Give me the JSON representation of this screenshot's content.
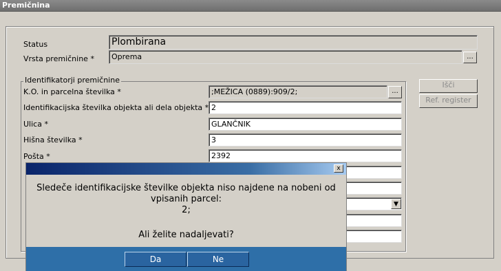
{
  "window": {
    "title": "Premičnina"
  },
  "status": {
    "label": "Status",
    "value": "Plombirana"
  },
  "vrsta": {
    "label": "Vrsta premičnine *",
    "value": "Oprema",
    "button": "..."
  },
  "group": {
    "label": "Identifikatorji premičnine",
    "fields": [
      {
        "label": "K.O. in parcelna številka *",
        "value": ";MEŽICA (0889):909/2;",
        "button": "..."
      },
      {
        "label": "Identifikacijska številka objekta ali dela objekta *",
        "value": "2"
      },
      {
        "label": "Ulica *",
        "value": "GLANČNIK"
      },
      {
        "label": "Hišna številka *",
        "value": "3"
      },
      {
        "label": "Pošta *",
        "value": "2392"
      }
    ]
  },
  "buttons": {
    "isci": "Išči",
    "ref_register": "Ref. register"
  },
  "dialog": {
    "close": "x",
    "line1": "Sledeče identifikacijske številke objekta niso najdene na nobeni od",
    "line2": "vpisanih parcel:",
    "line3": "2;",
    "question": "Ali želite nadaljevati?",
    "yes": "Da",
    "no": "Ne"
  },
  "icons": {
    "combo_arrow": "▼"
  }
}
